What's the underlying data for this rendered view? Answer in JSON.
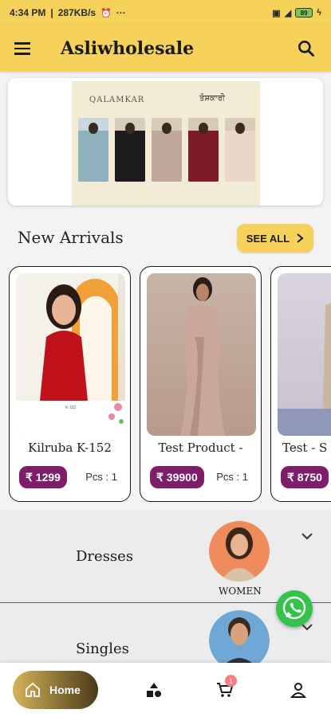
{
  "status_bar": {
    "time": "4:34 PM",
    "speed": "287KB/s",
    "alarm_icon": "alarm-icon",
    "more": "···",
    "battery": "89"
  },
  "app_bar": {
    "title": "Asliwholesale",
    "menu_icon": "menu-icon",
    "search_icon": "search-icon"
  },
  "banner": {
    "brand_left": "QALAMKAR",
    "brand_right": "ਤੋਸ਼ਕਾਰੀ"
  },
  "new_arrivals": {
    "title": "New Arrivals",
    "see_all_label": "SEE ALL",
    "products": [
      {
        "name": "Kilruba K-152",
        "price": "₹ 1299",
        "pcs": "Pcs : 1"
      },
      {
        "name": "Test Product -",
        "price": "₹ 39900",
        "pcs": "Pcs : 1"
      },
      {
        "name": "Test - S",
        "price": "₹ 8750",
        "pcs": ""
      }
    ]
  },
  "categories": [
    {
      "label": "Dresses",
      "caption": "WOMEN"
    },
    {
      "label": "Singles",
      "caption": ""
    }
  ],
  "bottom_nav": {
    "home_label": "Home",
    "cart_count": "1"
  },
  "colors": {
    "accent": "#f6d25a",
    "price_badge": "#7e1d6a",
    "whatsapp": "#34c24a"
  }
}
